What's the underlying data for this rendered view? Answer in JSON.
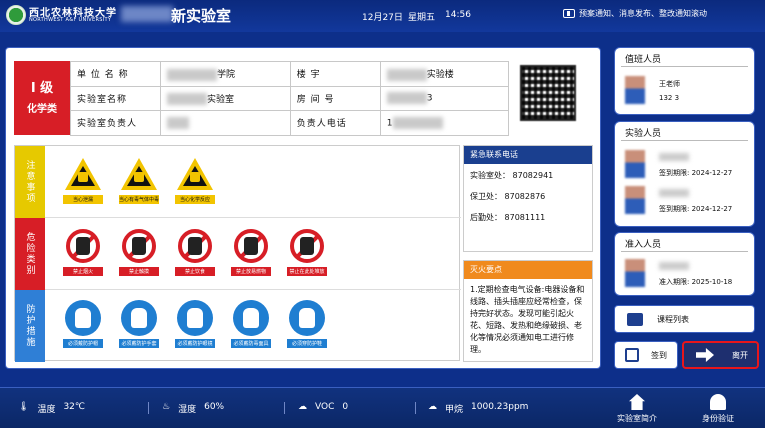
{
  "header": {
    "university_cn": "西北农林科技大学",
    "university_en": "NORTHWEST A&F UNIVERSITY",
    "lab_title": "新实验室",
    "date": "12月27日",
    "weekday": "星期五",
    "time": "14:56",
    "notice": "预案通知、消息发布、整改通知滚动"
  },
  "lab_info": {
    "level": "I 级",
    "category": "化学类",
    "rows": [
      {
        "label": "单 位 名 称",
        "value": "学院",
        "label2": "楼 宇",
        "value2": "实验楼"
      },
      {
        "label": "实验室名称",
        "value": "实验室",
        "label2": "房 间 号",
        "value2": "3"
      },
      {
        "label": "实验室负责人",
        "value": "",
        "label2": "负责人电话",
        "value2": "1"
      }
    ]
  },
  "hazards": {
    "notice_label": "注意事项",
    "danger_label": "危险类别",
    "protect_label": "防护措施",
    "notice_signs": [
      "当心泄漏",
      "当心有毒气体中毒",
      "当心化学反应"
    ],
    "danger_signs": [
      "禁止烟火",
      "禁止触摸",
      "禁止饮食",
      "禁止放易燃物",
      "禁止在此处堆放"
    ],
    "protect_signs": [
      "必须戴防护帽",
      "必须戴防护手套",
      "必须戴防护眼镜",
      "必须戴防毒面具",
      "必须穿防护鞋"
    ]
  },
  "emergency": {
    "title": "紧急联系电话",
    "items": [
      "实验室处： 87082941",
      "保卫处： 87082876",
      "后勤处： 87081111"
    ]
  },
  "fire": {
    "title": "灭火要点",
    "text": "1.定期检查电气设备:电器设备和线路、插头插座应经常检查，保持完好状态。发现可能引起火花、短路、发热和绝缘破损、老化等情况必须通知电工进行修理。"
  },
  "duty": {
    "title": "值班人员",
    "name": "王老师",
    "phone": "132 3"
  },
  "lab_staff": {
    "title": "实验人员",
    "people": [
      {
        "expiry": "签到期限: 2024-12-27"
      },
      {
        "expiry": "签到期限: 2024-12-27"
      }
    ]
  },
  "access": {
    "title": "准入人员",
    "people": [
      {
        "expiry": "准入期限: 2025-10-18"
      }
    ]
  },
  "buttons": {
    "schedule": "课程列表",
    "signin": "签到",
    "leave": "离开",
    "intro": "实验室简介",
    "identity": "身份验证"
  },
  "environment": {
    "temp_label": "温度",
    "temp_value": "32℃",
    "humidity_label": "湿度",
    "humidity_value": "60%",
    "voc_label": "VOC",
    "voc_value": "0",
    "formaldehyde_label": "甲烷",
    "formaldehyde_value": "1000.23ppm"
  }
}
